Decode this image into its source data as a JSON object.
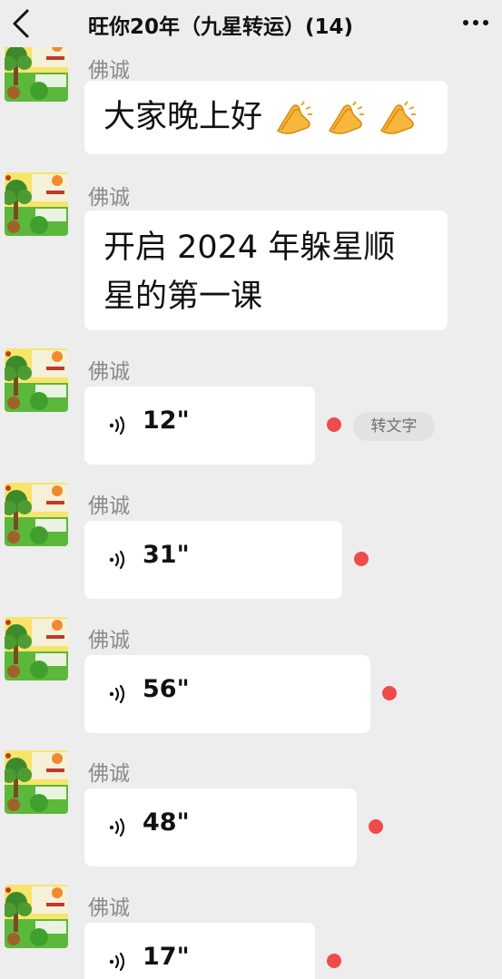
{
  "header": {
    "title": "旺你20年（九星转运）(14)",
    "back_icon": "chevron-left-icon",
    "more_icon": "more-dots-icon"
  },
  "messages": [
    {
      "sender": "佛诚",
      "type": "text",
      "lines": [
        "大家晚上好"
      ],
      "emoji": "clapping-hands-emoji",
      "emoji_count": 3
    },
    {
      "sender": "佛诚",
      "type": "text",
      "lines": [
        "开启 2024 年躲星顺",
        "星的第一课"
      ]
    },
    {
      "sender": "佛诚",
      "type": "voice",
      "duration": "12\"",
      "unread": true,
      "transcribe_label": "转文字"
    },
    {
      "sender": "佛诚",
      "type": "voice",
      "duration": "31\"",
      "unread": true
    },
    {
      "sender": "佛诚",
      "type": "voice",
      "duration": "56\"",
      "unread": true
    },
    {
      "sender": "佛诚",
      "type": "voice",
      "duration": "48\"",
      "unread": true
    },
    {
      "sender": "佛诚",
      "type": "voice",
      "duration": "17\"",
      "unread": true
    }
  ],
  "colors": {
    "background": "#ededed",
    "bubble": "#ffffff",
    "unread_dot": "#f04b4b",
    "sender_text": "#8a8a8a"
  }
}
